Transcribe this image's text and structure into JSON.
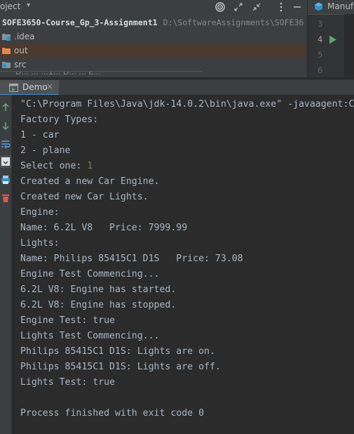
{
  "project": {
    "title": "oject",
    "root": {
      "name": "SOFE3650-Course_Gp_3-Assignment1",
      "path": "D:\\SoftwareAssignments\\SOFE36"
    },
    "items": [
      {
        "label": ".idea",
        "icon": "folder-idea-icon"
      },
      {
        "label": "out",
        "icon": "folder-out-icon"
      },
      {
        "label": "src",
        "icon": "folder-src-icon"
      }
    ],
    "cut_row_label": "D... ... ...1... D... ... E..."
  },
  "editor": {
    "tab_label": "Manufa",
    "gutter": [
      "3",
      "4",
      "5",
      "6"
    ]
  },
  "run": {
    "tab_label": "Demo",
    "close_glyph": "×",
    "console_lines": [
      "\"C:\\Program Files\\Java\\jdk-14.0.2\\bin\\java.exe\" -javaagent:C",
      "Factory Types:",
      "1 - car",
      "2 - plane",
      "Select one: ",
      "Created a new Car Engine.",
      "Created new Car Lights.",
      "Engine:",
      "Name: 6.2L V8   Price: 7999.99",
      "Lights:",
      "Name: Philips 85415C1 D1S   Price: 73.08",
      "Engine Test Commencing...",
      "6.2L V8: Engine has started.",
      "6.2L V8: Engine has stopped.",
      "Engine Test: true",
      "Lights Test Commencing...",
      "Philips 85415C1 D1S: Lights are on.",
      "Philips 85415C1 D1S: Lights are off.",
      "Lights Test: true",
      "",
      "Process finished with exit code 0"
    ],
    "user_input": "1"
  },
  "colors": {
    "console_text": "#a9b7c6",
    "user_input": "#6a8759",
    "panel_bg": "#3c3f41",
    "editor_bg": "#2b2b2b",
    "accent": "#4a88c7"
  }
}
